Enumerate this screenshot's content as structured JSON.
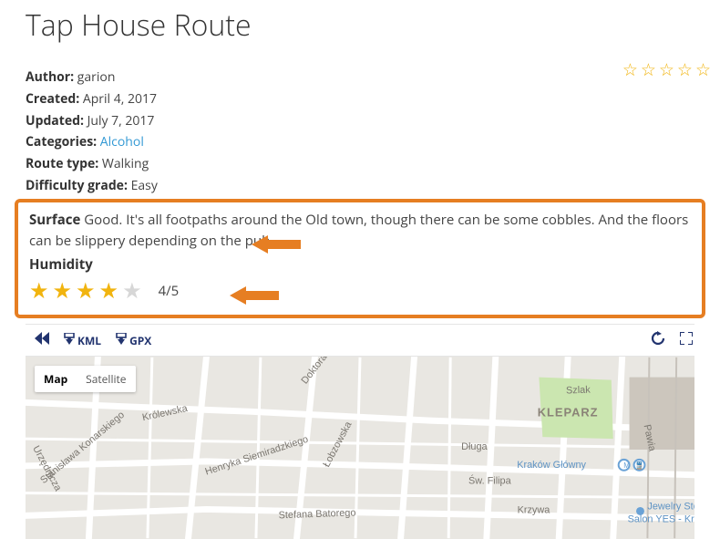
{
  "title": "Tap House Route",
  "meta": {
    "author_label": "Author:",
    "author": "garion",
    "created_label": "Created:",
    "created": "April 4, 2017",
    "updated_label": "Updated:",
    "updated": "July 7, 2017",
    "categories_label": "Categories:",
    "category": "Alcohol",
    "route_type_label": "Route type:",
    "route_type": "Walking",
    "difficulty_label": "Difficulty grade:",
    "difficulty": "Easy"
  },
  "surface": {
    "label": "Surface",
    "text": "Good. It's all footpaths around the Old town, though there can be some cobbles. And the floors can be slippery depending on the pub."
  },
  "humidity": {
    "label": "Humidity",
    "rating": 4,
    "max": 5,
    "score_text": "4/5"
  },
  "rating_overall": {
    "value": 0,
    "max": 5
  },
  "toolbar": {
    "back": "◀◀",
    "kml": "KML",
    "gpx": "GPX"
  },
  "map": {
    "type_map": "Map",
    "type_sat": "Satellite",
    "district": "KLEPARZ",
    "streets": {
      "szlak": "Szlak",
      "dluga": "Długa",
      "filipa": "Św. Filipa",
      "krzywa": "Krzywa",
      "pawia": "Pawia",
      "krolewska": "Królewska",
      "konarskiego": "Stanisława Konarskiego",
      "batorego": "Stefana Batorego",
      "siemiradzkiego": "Henryka Siemiradzkiego",
      "lobzowska": "Łobzowska",
      "urzednicza": "Urzędnicza",
      "doktora": "Doktora"
    },
    "poi": {
      "station": "Kraków Główny",
      "store": "Jewelry Store",
      "store2": "Salon YES - Kraków"
    }
  }
}
